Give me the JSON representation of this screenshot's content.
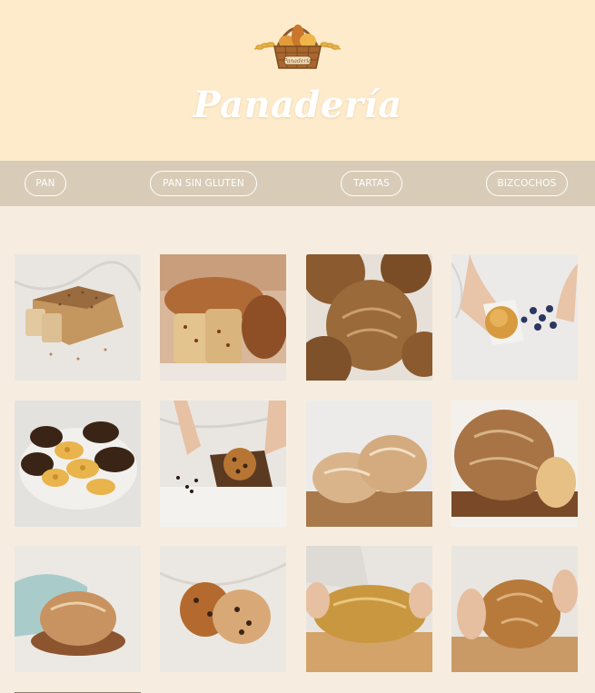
{
  "header": {
    "title": "Panadería",
    "logo_text": "Panadería"
  },
  "nav": {
    "items": [
      {
        "label": "PAN"
      },
      {
        "label": "PAN SIN GLUTEN"
      },
      {
        "label": "TARTAS"
      },
      {
        "label": "BIZCOCHOS"
      }
    ]
  },
  "products": [
    {
      "image": "sliced-seeded-loaf"
    },
    {
      "image": "sliced-fruit-loaf"
    },
    {
      "image": "round-sourdough-loaves"
    },
    {
      "image": "muffin-with-blueberries"
    },
    {
      "image": "chocolate-palmeras"
    },
    {
      "image": "chocolate-chip-muffin"
    },
    {
      "image": "two-round-loaves-on-board"
    },
    {
      "image": "country-loaf-in-basket"
    },
    {
      "image": "loaf-on-wooden-plate"
    },
    {
      "image": "chocolate-chip-rolls"
    },
    {
      "image": "hands-holding-oval-loaf"
    },
    {
      "image": "hands-holding-round-loaf"
    }
  ],
  "colors": {
    "header_bg": "#fdebcc",
    "nav_bg": "#d8ccb8",
    "page_bg": "#f6ede0"
  }
}
